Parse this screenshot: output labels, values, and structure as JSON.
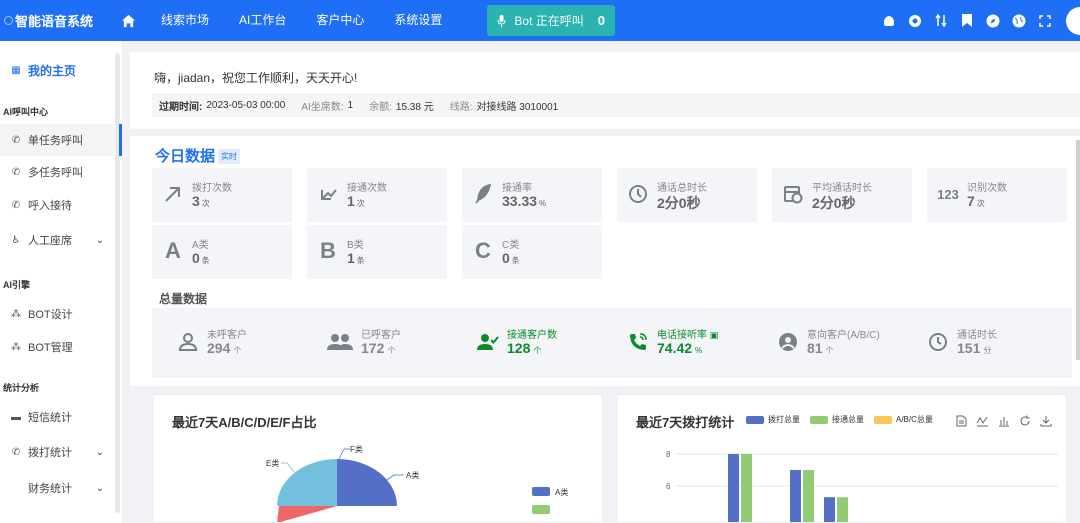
{
  "app": {
    "title": "智能语音系统"
  },
  "nav": {
    "items": [
      "线索市场",
      "AI工作台",
      "客户中心",
      "系统设置"
    ]
  },
  "bot": {
    "label": "Bot 正在呼叫",
    "count": "0"
  },
  "sidebar": {
    "home": "我的主页",
    "section_ai_call": "AI呼叫中心",
    "single_task": "单任务呼叫",
    "multi_task": "多任务呼叫",
    "inbound": "呼入接待",
    "manual_seat": "人工座席",
    "section_ai_engine": "AI引擎",
    "bot_design": "BOT设计",
    "bot_manage": "BOT管理",
    "section_stats": "统计分析",
    "sms_stats": "短信统计",
    "dial_stats": "拨打统计",
    "finance_stats": "财务统计"
  },
  "greeting": "嗨，jiadan，祝您工作顺利，天天开心!",
  "info": {
    "expire_label": "过期时间:",
    "expire_value": "2023-05-03 00:00",
    "seats_label": "AI坐席数:",
    "seats_value": "1",
    "balance_label": "余额:",
    "balance_value": "15.38 元",
    "line_label": "线路:",
    "line_value": "对接线路 3010001"
  },
  "today": {
    "title": "今日数据",
    "tag": "实时",
    "stats": [
      {
        "label": "拨打次数",
        "value": "3",
        "unit": "次",
        "icon": "arrow-up-right-icon"
      },
      {
        "label": "接通次数",
        "value": "1",
        "unit": "次",
        "icon": "arrow-down-left-icon"
      },
      {
        "label": "接通率",
        "value": "33.33",
        "unit": "%",
        "icon": "feather-icon"
      },
      {
        "label": "通话总时长",
        "value": "2分0秒",
        "unit": "",
        "icon": "clock-icon"
      },
      {
        "label": "平均通话时长",
        "value": "2分0秒",
        "unit": "",
        "icon": "schedule-icon"
      },
      {
        "label": "识别次数",
        "value": "7",
        "unit": "次",
        "icon": "numbers-icon"
      },
      {
        "label": "A类",
        "value": "0",
        "unit": "条",
        "icon": "letter-a-icon"
      },
      {
        "label": "B类",
        "value": "1",
        "unit": "条",
        "icon": "letter-b-icon"
      },
      {
        "label": "C类",
        "value": "0",
        "unit": "条",
        "icon": "letter-c-icon"
      }
    ]
  },
  "totals": {
    "title": "总量数据",
    "items": [
      {
        "label": "未呼客户",
        "value": "294",
        "unit": "个",
        "icon": "person-icon"
      },
      {
        "label": "已呼客户",
        "value": "172",
        "unit": "个",
        "icon": "people-icon"
      },
      {
        "label": "接通客户数",
        "value": "128",
        "unit": "个",
        "icon": "person-check-icon"
      },
      {
        "label": "电话接听率",
        "value": "74.42",
        "unit": "%",
        "icon": "phone-icon"
      },
      {
        "label": "意向客户(A/B/C)",
        "value": "81",
        "unit": "个",
        "icon": "account-circle-icon"
      },
      {
        "label": "通话时长",
        "value": "151",
        "unit": "分",
        "icon": "timer-icon"
      }
    ]
  },
  "colors": {
    "primary": "#1e6ff5",
    "bot": "#2ab3b0",
    "green": "#0c8a2c"
  },
  "chart_data": [
    {
      "type": "pie",
      "title": "最近7天A/B/C/D/E/F占比",
      "categories": [
        "A类",
        "E类",
        "F类"
      ],
      "legend": [
        "A类"
      ],
      "colors": [
        "#5470c6",
        "#73c0de",
        "#ee6666"
      ]
    },
    {
      "type": "bar",
      "title": "最近7天拨打统计",
      "series": [
        {
          "name": "拨打总量",
          "values": [
            8,
            7,
            5.3
          ],
          "color": "#5470c6"
        },
        {
          "name": "接通总量",
          "values": [
            8,
            7,
            5.3
          ],
          "color": "#91cc75"
        },
        {
          "name": "A/B/C总量",
          "values": [
            0,
            0,
            0
          ],
          "color": "#fac858"
        }
      ],
      "y_ticks": [
        "8",
        "6"
      ]
    }
  ]
}
